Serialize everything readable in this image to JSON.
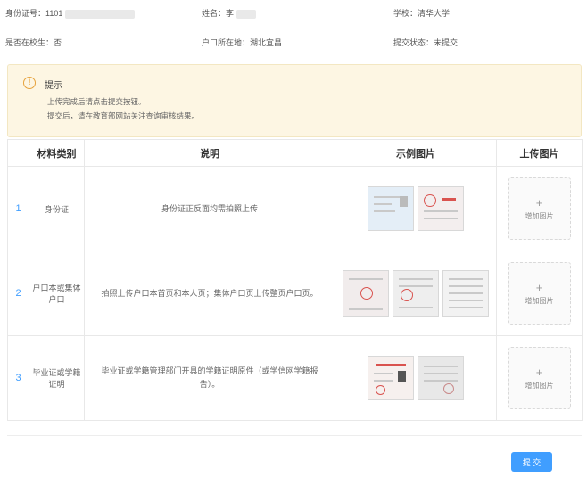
{
  "info": {
    "id_label": "身份证号：1101",
    "name_label": "姓名：李",
    "school": "学校：清华大学",
    "enrolled": "是否在校生：否",
    "hukou": "户口所在地：湖北宜昌",
    "status": "提交状态：未提交"
  },
  "notice": {
    "title": "提示",
    "lines": [
      "上传完成后请点击提交按钮。",
      "提交后，请在教育部网站关注查询审核结果。"
    ]
  },
  "table": {
    "headers": [
      "材料类别",
      "说明",
      "示例图片",
      "上传图片"
    ],
    "rows": [
      {
        "index": "1",
        "category": "身份证",
        "description": "身份证正反面均需拍照上传",
        "upload_label": "增加图片"
      },
      {
        "index": "2",
        "category": "户口本或集体户口",
        "description": "拍照上传户口本首页和本人页；集体户口页上传整页户口页。",
        "upload_label": "增加图片"
      },
      {
        "index": "3",
        "category": "毕业证或学籍证明",
        "description": "毕业证或学籍管理部门开具的学籍证明原件（或学信网学籍报告）。",
        "upload_label": "增加图片"
      }
    ]
  },
  "icons": {
    "warning": "warning-icon",
    "plus": "plus-icon"
  },
  "submit_label": "提 交",
  "colors": {
    "accent": "#409eff",
    "notice_bg": "#fdf6e3",
    "warning": "#e6a23c"
  }
}
